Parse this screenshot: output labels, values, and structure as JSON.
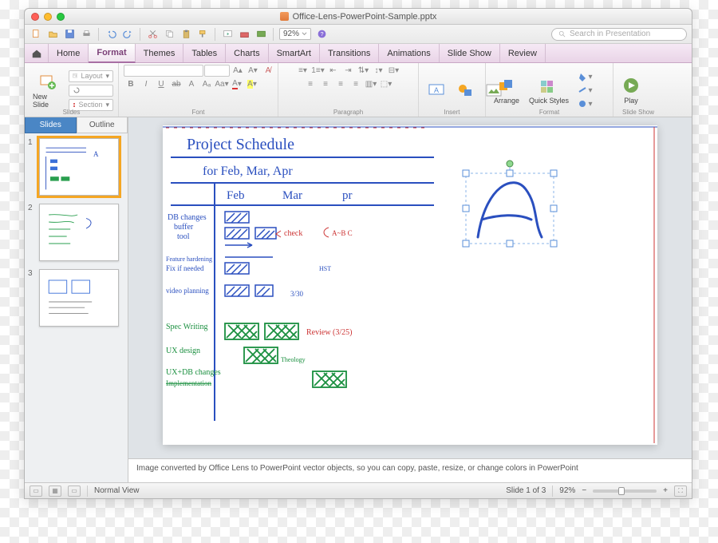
{
  "window": {
    "title": "Office-Lens-PowerPoint-Sample.pptx"
  },
  "qat": {
    "zoom_value": "92%",
    "search_placeholder": "Search in Presentation"
  },
  "ribbon": {
    "tabs": [
      "Home",
      "Format",
      "Themes",
      "Tables",
      "Charts",
      "SmartArt",
      "Transitions",
      "Animations",
      "Slide Show",
      "Review"
    ],
    "active_index": 1,
    "groups": {
      "slides": {
        "label": "Slides",
        "new_slide": "New Slide",
        "layout": "Layout",
        "section": "Section"
      },
      "font": {
        "label": "Font"
      },
      "paragraph": {
        "label": "Paragraph"
      },
      "insert": {
        "label": "Insert"
      },
      "format": {
        "label": "Format",
        "arrange": "Arrange",
        "quick_styles": "Quick Styles"
      },
      "slide_show": {
        "label": "Slide Show",
        "play": "Play"
      }
    }
  },
  "panel": {
    "tabs": [
      "Slides",
      "Outline"
    ],
    "active": 0,
    "thumb_count": 3
  },
  "slide_content": {
    "title": "Project  Schedule",
    "subtitle": "for   Feb, Mar, Apr",
    "cols": [
      "Feb",
      "Mar",
      "pr"
    ],
    "rows": [
      "DB changes",
      "buffer",
      "tool",
      "Feature hardening",
      "Fix if needed",
      "video planning",
      "Spec Writing",
      "UX design",
      "UX+DB changes",
      "Implementation"
    ],
    "annot_check": "check",
    "annot_review": "Review (3/25)",
    "annot_abc": "A~B C",
    "annot_date": "3/30",
    "annot_hst": "HST"
  },
  "notes": {
    "text": "Image converted by Office Lens to PowerPoint vector objects, so you can copy, paste, resize, or change colors in PowerPoint"
  },
  "statusbar": {
    "view_label": "Normal View",
    "slide_counter": "Slide 1 of 3",
    "zoom": "92%"
  }
}
